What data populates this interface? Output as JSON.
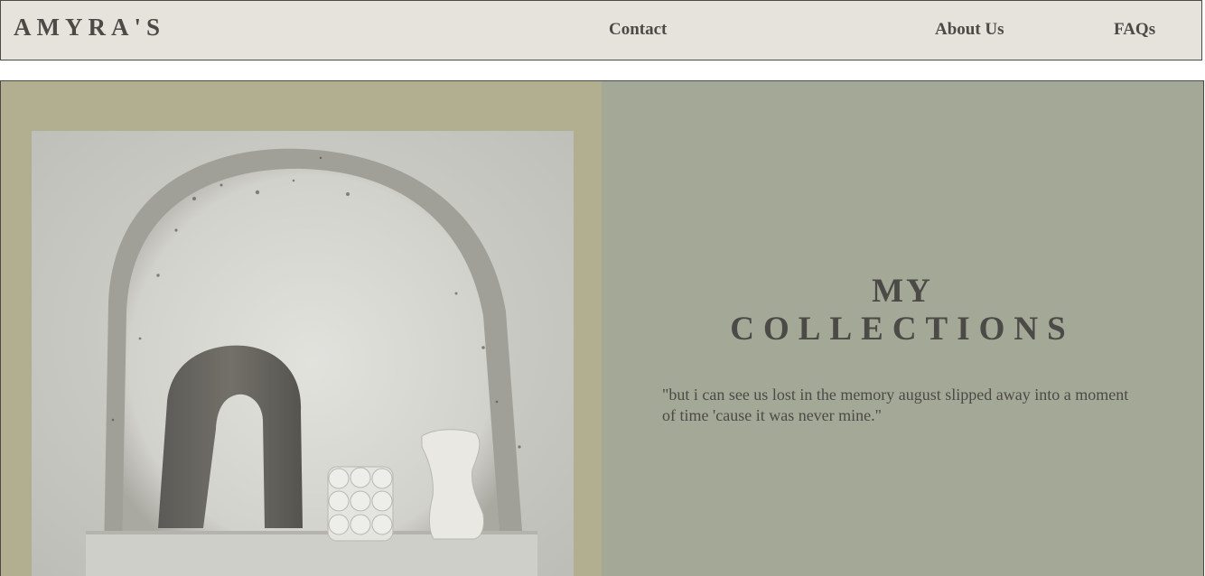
{
  "header": {
    "logo": "AMYRA'S",
    "nav": {
      "contact": "Contact",
      "about": "About Us",
      "faqs": "FAQs"
    }
  },
  "hero": {
    "title_line1": "MY",
    "title_line2": "COLLECTIONS",
    "quote": "\"but i can see us lost in the memory august slipped away into a moment of time 'cause it was never mine.\""
  },
  "colors": {
    "header_bg": "#e6e3dc",
    "left_panel": "#b2ae90",
    "right_panel": "#a4a897",
    "text": "#4b4a47"
  }
}
